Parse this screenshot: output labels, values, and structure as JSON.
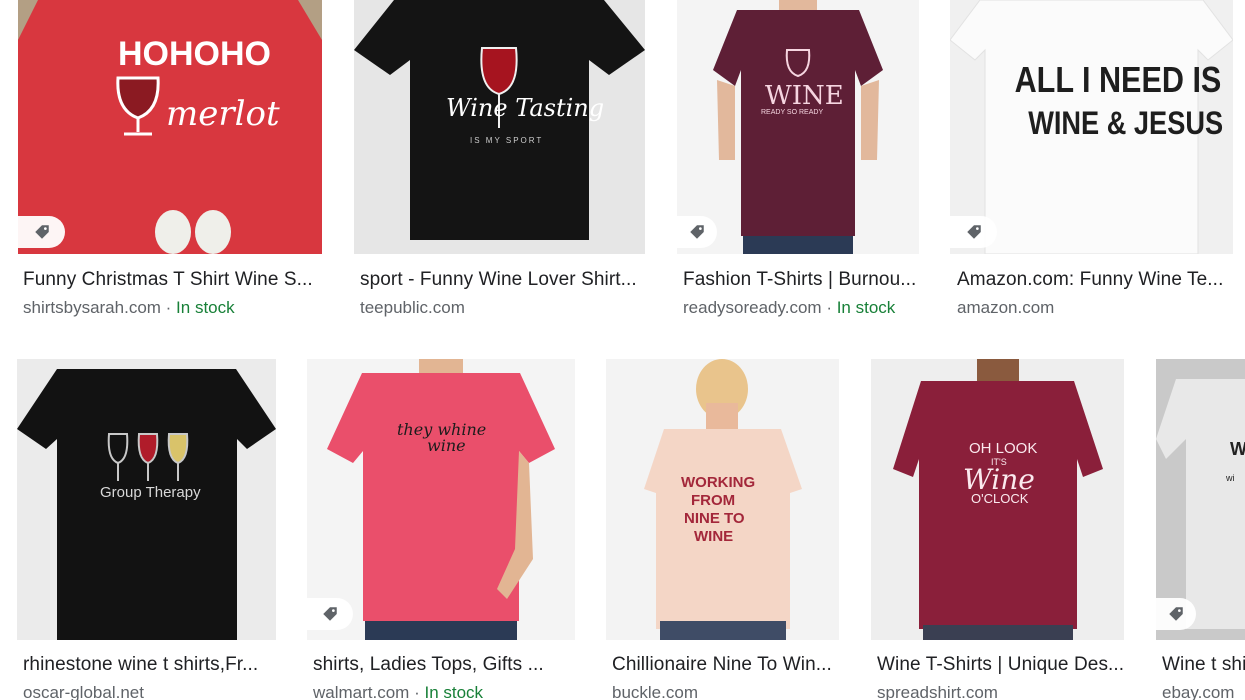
{
  "results": [
    {
      "title": "Funny Christmas T Shirt Wine S...",
      "source": "shirtsbysarah.com",
      "sep": " · ",
      "stock": "In stock",
      "shirt_color": "#d8373f",
      "bg": "#b8a68c",
      "print": [
        "HO HO HO",
        "merlot"
      ]
    },
    {
      "title": "sport - Funny Wine Lover Shirt...",
      "source": "teepublic.com",
      "sep": "",
      "stock": "",
      "shirt_color": "#141414",
      "bg": "#e4e4e4",
      "print": [
        "Wine Tasting",
        "IS MY SPORT"
      ]
    },
    {
      "title": "Fashion T-Shirts | Burnou...",
      "source": "readysoready.com",
      "sep": " · ",
      "stock": "In stock",
      "shirt_color": "#5e1f36",
      "bg": "#f2f2f2",
      "print": [
        "WINE",
        "READY SO READY"
      ]
    },
    {
      "title": "Amazon.com: Funny Wine Te...",
      "source": "amazon.com",
      "sep": "",
      "stock": "",
      "shirt_color": "#f4f4f4",
      "bg": "#eeeeee",
      "print": [
        "ALL I NEED IS",
        "WINE & JESUS"
      ]
    },
    {
      "title": "rhinestone wine t shirts,Fr...",
      "source": "oscar-global.net",
      "sep": "",
      "stock": "",
      "shirt_color": "#121212",
      "bg": "#ececec",
      "print": [
        "Group Therapy"
      ]
    },
    {
      "title": "shirts, Ladies Tops, Gifts ...",
      "source": "walmart.com",
      "sep": " · ",
      "stock": "In stock",
      "shirt_color": "#ea4f6b",
      "bg": "#f4f4f4",
      "print": [
        "they whine",
        "wine"
      ]
    },
    {
      "title": "Chillionaire Nine To Win...",
      "source": "buckle.com",
      "sep": "",
      "stock": "",
      "shirt_color": "#f4d6c6",
      "bg": "#f3f3f3",
      "print": [
        "WORKING",
        "FROM",
        "NINE TO",
        "WINE"
      ]
    },
    {
      "title": "Wine T-Shirts | Unique Des...",
      "source": "spreadshirt.com",
      "sep": "",
      "stock": "",
      "shirt_color": "#8a1f3a",
      "bg": "#ededed",
      "print": [
        "OH LOOK",
        "IT'S",
        "Wine",
        "O'CLOCK"
      ]
    },
    {
      "title": "Wine t shi",
      "source": "ebay.com",
      "sep": "",
      "stock": "",
      "shirt_color": "#d9d9d9",
      "bg": "#c8c8c8",
      "print": [
        "W",
        "wi"
      ]
    }
  ],
  "icons": {
    "tag": "price-tag-icon"
  }
}
